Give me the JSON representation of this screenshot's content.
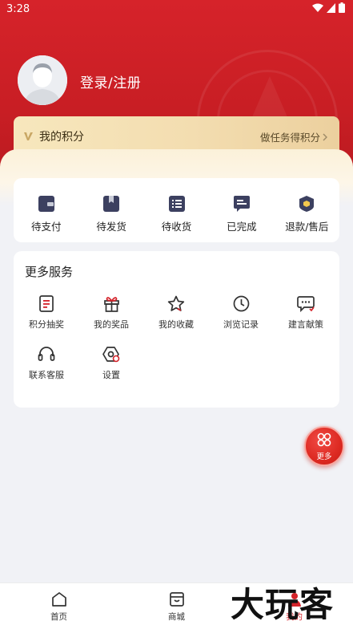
{
  "status": {
    "time": "3:28"
  },
  "profile": {
    "login_label": "登录/注册"
  },
  "points": {
    "label": "我的积分",
    "action": "做任务得积分"
  },
  "orders": [
    {
      "label": "待支付",
      "icon": "wallet-icon"
    },
    {
      "label": "待发货",
      "icon": "box-icon"
    },
    {
      "label": "待收货",
      "icon": "list-icon"
    },
    {
      "label": "已完成",
      "icon": "completed-icon"
    },
    {
      "label": "退款/售后",
      "icon": "shield-icon"
    }
  ],
  "services": {
    "title": "更多服务",
    "items": [
      {
        "label": "积分抽奖",
        "icon": "document-icon"
      },
      {
        "label": "我的奖品",
        "icon": "gift-icon"
      },
      {
        "label": "我的收藏",
        "icon": "star-icon"
      },
      {
        "label": "浏览记录",
        "icon": "clock-icon"
      },
      {
        "label": "建言献策",
        "icon": "message-icon"
      },
      {
        "label": "联系客服",
        "icon": "headset-icon"
      },
      {
        "label": "设置",
        "icon": "settings-icon"
      }
    ]
  },
  "float_button": {
    "label": "更多"
  },
  "tabs": [
    {
      "label": "首页",
      "icon": "home-icon"
    },
    {
      "label": "商城",
      "icon": "store-icon"
    },
    {
      "label": "我的",
      "icon": "user-icon"
    }
  ],
  "watermark": "大玩客",
  "colors": {
    "brand_red": "#d4232a",
    "gold": "#f3ddb0",
    "icon_dark": "#3c4060"
  }
}
